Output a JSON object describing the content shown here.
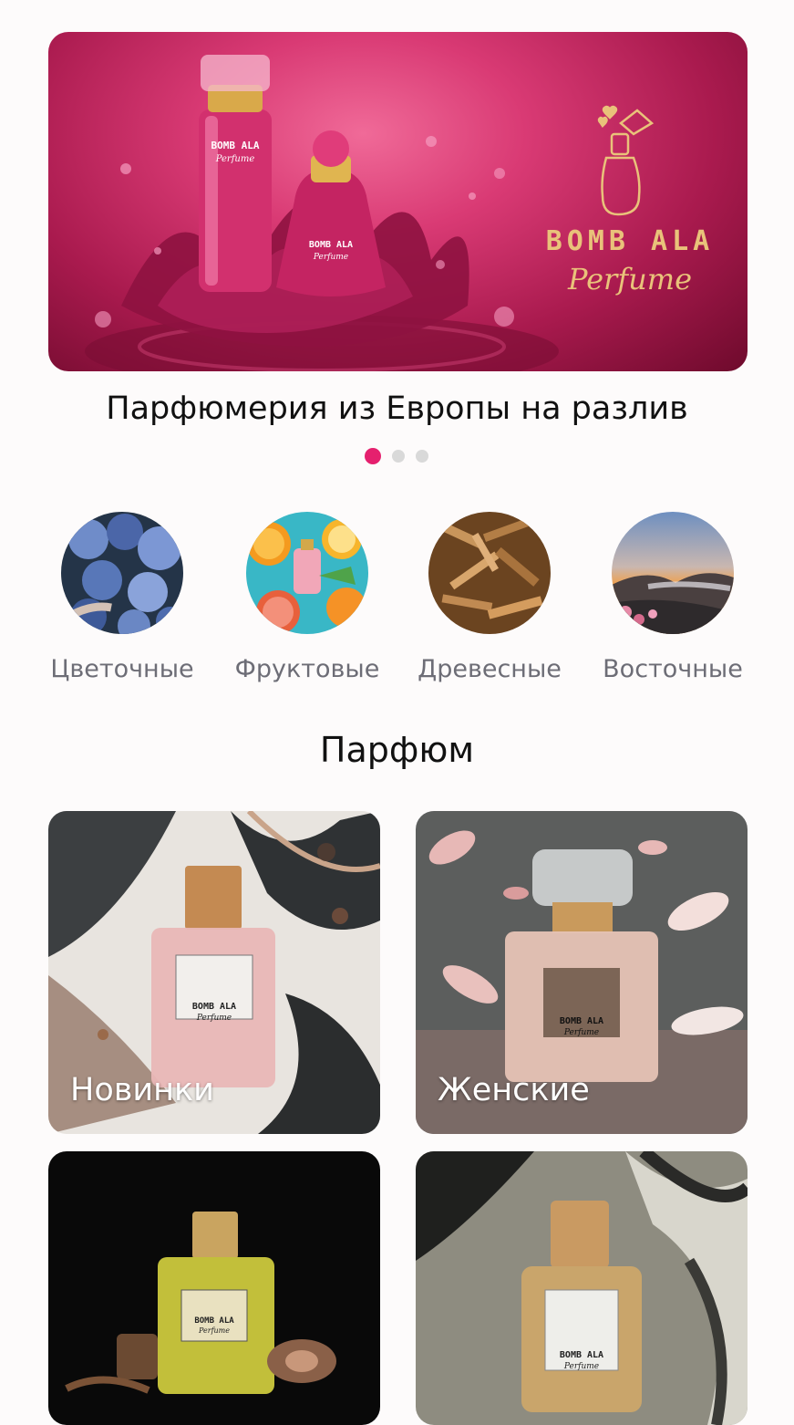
{
  "banner": {
    "brand_name": "BOMB ALA",
    "brand_sub": "Perfume",
    "caption": "Парфюмерия из Европы на разлив",
    "active_slide": 1,
    "slide_count": 3,
    "accent": "#e5206e"
  },
  "categories": [
    {
      "label": "Цветочные",
      "icon": "flowers-image"
    },
    {
      "label": "Фруктовые",
      "icon": "fruits-image"
    },
    {
      "label": "Древесные",
      "icon": "wood-chips-image"
    },
    {
      "label": "Восточные",
      "icon": "sunset-landscape-image"
    }
  ],
  "section": {
    "title": "Парфюм"
  },
  "tiles": [
    {
      "label": "Новинки",
      "bottle_brand": "BOMB ALA",
      "bottle_sub": "Perfume"
    },
    {
      "label": "Женские",
      "bottle_brand": "BOMB ALA",
      "bottle_sub": "Perfume"
    },
    {
      "label": "",
      "bottle_brand": "BOMB ALA",
      "bottle_sub": "Perfume"
    },
    {
      "label": "",
      "bottle_brand": "BOMB ALA",
      "bottle_sub": "Perfume"
    }
  ]
}
